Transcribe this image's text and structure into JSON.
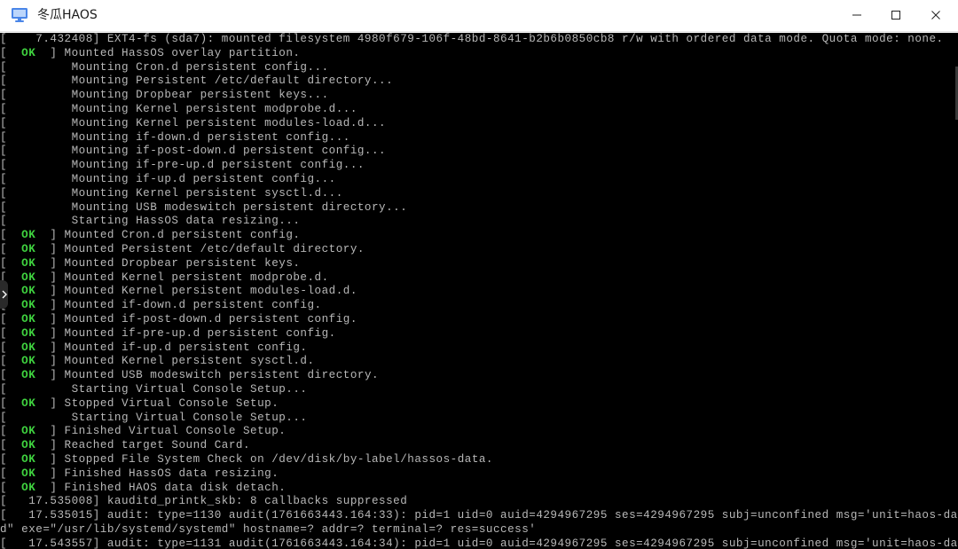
{
  "window": {
    "title": "冬瓜HAOS",
    "icon": "monitor-icon",
    "controls": {
      "minimize_icon": "minimize-icon",
      "maximize_icon": "maximize-icon",
      "close_icon": "close-icon"
    }
  },
  "colors": {
    "terminal_bg": "#000000",
    "terminal_text": "#b8b8b8",
    "ok_status": "#3fd23f",
    "titlebar_bg": "#ffffff"
  },
  "console": {
    "lines": [
      {
        "status": "",
        "text": "    7.432408] EXT4-fs (sda7): mounted filesystem 4980f679-106f-48bd-8641-b2b6b0850cb8 r/w with ordered data mode. Quota mode: none."
      },
      {
        "status": "  OK  ",
        "text": "] Mounted HassOS overlay partition."
      },
      {
        "status": "",
        "text": "         Mounting Cron.d persistent config..."
      },
      {
        "status": "",
        "text": "         Mounting Persistent /etc/default directory..."
      },
      {
        "status": "",
        "text": "         Mounting Dropbear persistent keys..."
      },
      {
        "status": "",
        "text": "         Mounting Kernel persistent modprobe.d..."
      },
      {
        "status": "",
        "text": "         Mounting Kernel persistent modules-load.d..."
      },
      {
        "status": "",
        "text": "         Mounting if-down.d persistent config..."
      },
      {
        "status": "",
        "text": "         Mounting if-post-down.d persistent config..."
      },
      {
        "status": "",
        "text": "         Mounting if-pre-up.d persistent config..."
      },
      {
        "status": "",
        "text": "         Mounting if-up.d persistent config..."
      },
      {
        "status": "",
        "text": "         Mounting Kernel persistent sysctl.d..."
      },
      {
        "status": "",
        "text": "         Mounting USB modeswitch persistent directory..."
      },
      {
        "status": "",
        "text": "         Starting HassOS data resizing..."
      },
      {
        "status": "  OK  ",
        "text": "] Mounted Cron.d persistent config."
      },
      {
        "status": "  OK  ",
        "text": "] Mounted Persistent /etc/default directory."
      },
      {
        "status": "  OK  ",
        "text": "] Mounted Dropbear persistent keys."
      },
      {
        "status": "  OK  ",
        "text": "] Mounted Kernel persistent modprobe.d."
      },
      {
        "status": "  OK  ",
        "text": "] Mounted Kernel persistent modules-load.d."
      },
      {
        "status": "  OK  ",
        "text": "] Mounted if-down.d persistent config."
      },
      {
        "status": "  OK  ",
        "text": "] Mounted if-post-down.d persistent config."
      },
      {
        "status": "  OK  ",
        "text": "] Mounted if-pre-up.d persistent config."
      },
      {
        "status": "  OK  ",
        "text": "] Mounted if-up.d persistent config."
      },
      {
        "status": "  OK  ",
        "text": "] Mounted Kernel persistent sysctl.d."
      },
      {
        "status": "  OK  ",
        "text": "] Mounted USB modeswitch persistent directory."
      },
      {
        "status": "",
        "text": "         Starting Virtual Console Setup..."
      },
      {
        "status": "  OK  ",
        "text": "] Stopped Virtual Console Setup."
      },
      {
        "status": "",
        "text": "         Starting Virtual Console Setup..."
      },
      {
        "status": "  OK  ",
        "text": "] Finished Virtual Console Setup."
      },
      {
        "status": "  OK  ",
        "text": "] Reached target Sound Card."
      },
      {
        "status": "  OK  ",
        "text": "] Stopped File System Check on /dev/disk/by-label/hassos-data."
      },
      {
        "status": "  OK  ",
        "text": "] Finished HassOS data resizing."
      },
      {
        "status": "  OK  ",
        "text": "] Finished HAOS data disk detach."
      },
      {
        "status": "",
        "text": "   17.535008] kauditd_printk_skb: 8 callbacks suppressed"
      },
      {
        "status": "",
        "text": "   17.535015] audit: type=1130 audit(1761663443.164:33): pid=1 uid=0 auid=4294967295 ses=4294967295 subj=unconfined msg='unit=haos-data-d"
      },
      {
        "status": "",
        "text": "d\" exe=\"/usr/lib/systemd/systemd\" hostname=? addr=? terminal=? res=success'"
      },
      {
        "status": "",
        "text": "   17.543557] audit: type=1131 audit(1761663443.164:34): pid=1 uid=0 auid=4294967295 ses=4294967295 subj=unconfined msg='unit=haos-data-d"
      }
    ]
  }
}
